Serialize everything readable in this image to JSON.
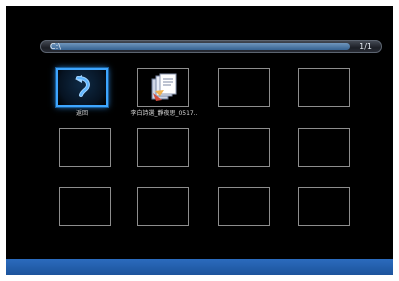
{
  "path_bar": {
    "path": "C:\\",
    "page": "1/1"
  },
  "grid": {
    "items": [
      {
        "label": "返回",
        "icon": "back-arrow-icon",
        "selected": true
      },
      {
        "label": "李白詩選_靜夜思_0517..",
        "icon": "document-icon",
        "selected": false
      },
      {
        "label": "",
        "icon": "",
        "selected": false
      },
      {
        "label": "",
        "icon": "",
        "selected": false
      },
      {
        "label": "",
        "icon": "",
        "selected": false
      },
      {
        "label": "",
        "icon": "",
        "selected": false
      },
      {
        "label": "",
        "icon": "",
        "selected": false
      },
      {
        "label": "",
        "icon": "",
        "selected": false
      },
      {
        "label": "",
        "icon": "",
        "selected": false
      },
      {
        "label": "",
        "icon": "",
        "selected": false
      },
      {
        "label": "",
        "icon": "",
        "selected": false
      },
      {
        "label": "",
        "icon": "",
        "selected": false
      }
    ]
  },
  "colors": {
    "accent": "#3ea6ff",
    "bottom_bar": "#2b6bbd",
    "background": "#000000"
  }
}
